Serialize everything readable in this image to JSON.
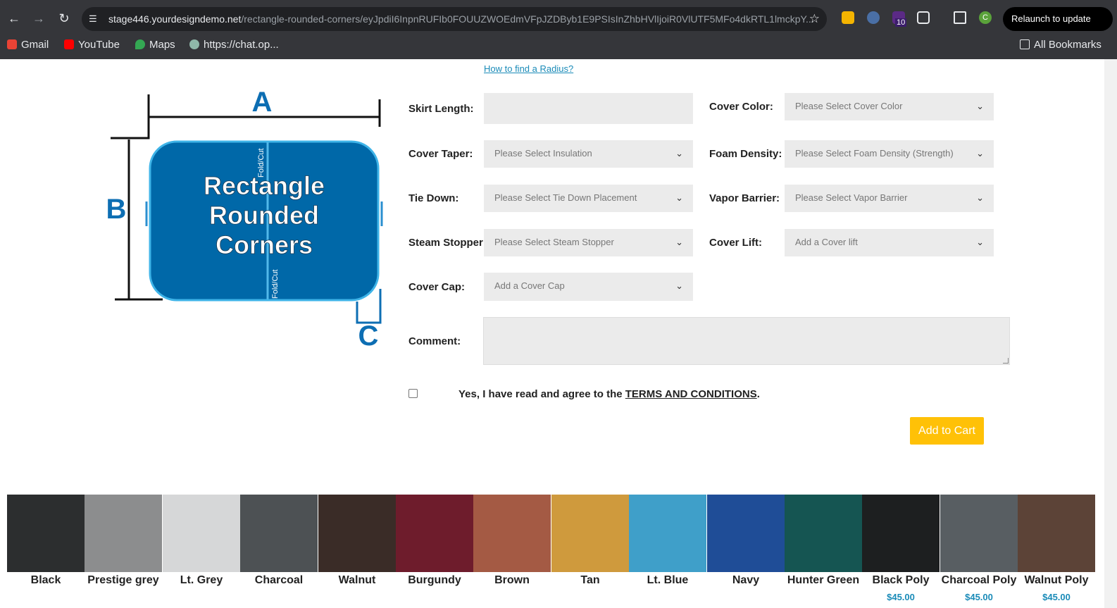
{
  "browser": {
    "url_host": "stage446.yourdesigndemo.net",
    "url_path": "/rectangle-rounded-corners/eyJpdiI6InpnRUFIb0FOUUZWOEdmVFpJZDByb1E9PSIsInZhbHVlIjoiR0VlUTF5MFo4dkRTL1lmckpY...",
    "relaunch_label": "Relaunch to update",
    "ext_badge": "10",
    "profile_initial": "C",
    "bookmarks": [
      "Gmail",
      "YouTube",
      "Maps",
      "https://chat.op..."
    ],
    "all_bookmarks": "All Bookmarks"
  },
  "help_link": "How to find a Radius?",
  "diagram": {
    "title_line1": "Rectangle",
    "title_line2": "Rounded",
    "title_line3": "Corners",
    "label_a": "A",
    "label_b": "B",
    "label_c": "C",
    "fold_cut": "Fold/Cut"
  },
  "form": {
    "skirt_length": {
      "label": "Skirt Length:",
      "value": ""
    },
    "cover_color": {
      "label": "Cover Color:",
      "placeholder": "Please Select Cover Color"
    },
    "cover_taper": {
      "label": "Cover Taper:",
      "placeholder": "Please Select Insulation"
    },
    "foam_density": {
      "label": "Foam Density:",
      "placeholder": "Please Select Foam Density (Strength)"
    },
    "tie_down": {
      "label": "Tie Down:",
      "placeholder": "Please Select Tie Down Placement"
    },
    "vapor_barrier": {
      "label": "Vapor Barrier:",
      "placeholder": "Please Select Vapor Barrier"
    },
    "steam_stopper": {
      "label": "Steam Stopper:",
      "placeholder": "Please Select Steam Stopper"
    },
    "cover_lift": {
      "label": "Cover Lift:",
      "placeholder": "Add a Cover lift"
    },
    "cover_cap": {
      "label": "Cover Cap:",
      "placeholder": "Add a Cover Cap"
    },
    "comment": {
      "label": "Comment:",
      "value": ""
    },
    "terms_prefix": "Yes, I have read and agree to the ",
    "terms_link": "TERMS AND CONDITIONS",
    "terms_suffix": ".",
    "add_to_cart": "Add to Cart"
  },
  "swatches": [
    {
      "name": "Black",
      "color": "#2c2e2f",
      "price": ""
    },
    {
      "name": "Prestige grey",
      "color": "#8c8d8e",
      "price": ""
    },
    {
      "name": "Lt. Grey",
      "color": "#d6d7d8",
      "price": ""
    },
    {
      "name": "Charcoal",
      "color": "#4d5154",
      "price": ""
    },
    {
      "name": "Walnut",
      "color": "#3a2c27",
      "price": ""
    },
    {
      "name": "Burgundy",
      "color": "#6e1c2c",
      "price": ""
    },
    {
      "name": "Brown",
      "color": "#a45a44",
      "price": ""
    },
    {
      "name": "Tan",
      "color": "#cf9a3d",
      "price": ""
    },
    {
      "name": "Lt. Blue",
      "color": "#3f9fc9",
      "price": ""
    },
    {
      "name": "Navy",
      "color": "#1f4d97",
      "price": ""
    },
    {
      "name": "Hunter Green",
      "color": "#155552",
      "price": ""
    },
    {
      "name": "Black Poly",
      "color": "#1d1f20",
      "price": "$45.00"
    },
    {
      "name": "Charcoal Poly",
      "color": "#585e62",
      "price": "$45.00"
    },
    {
      "name": "Walnut Poly",
      "color": "#5c4337",
      "price": "$45.00"
    }
  ]
}
